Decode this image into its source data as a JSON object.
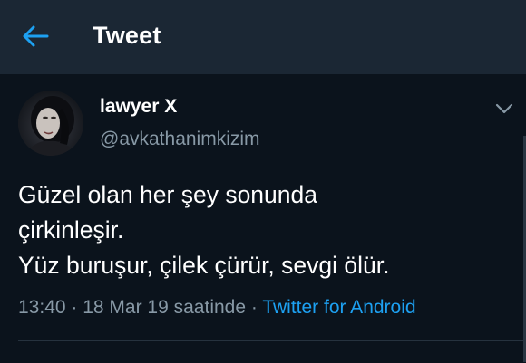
{
  "header": {
    "back_icon": "arrow-left-icon",
    "title": "Tweet",
    "accent_color": "#1da1f2"
  },
  "tweet": {
    "author": {
      "display_name": "lawyer X",
      "handle": "@avkathanimkizim",
      "avatar_icon": "profile-photo"
    },
    "menu_icon": "chevron-down-icon",
    "text_lines": [
      "Güzel olan her şey sonunda",
      "çirkinleşir.",
      "Yüz buruşur, çilek çürür, sevgi ölür."
    ],
    "meta": {
      "time": "13:40",
      "separator": " · ",
      "date": "18 Mar 19 saatinde",
      "source": "Twitter for Android"
    }
  }
}
